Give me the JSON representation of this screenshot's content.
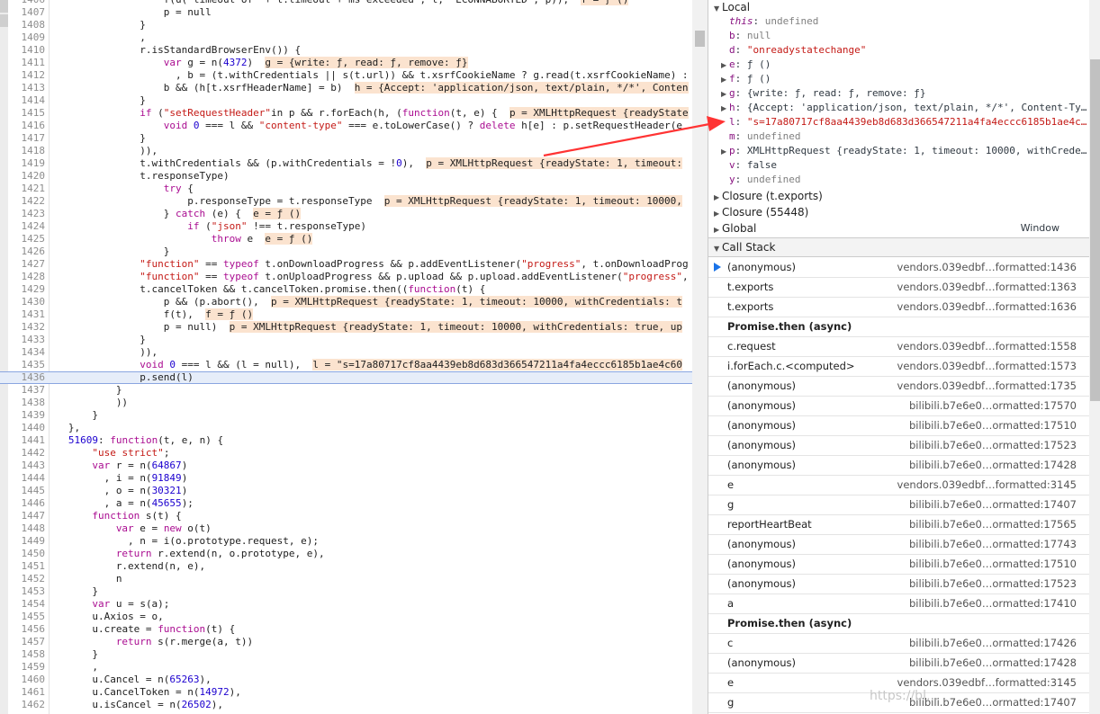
{
  "code_lines": [
    {
      "n": "1406",
      "indent": 19,
      "parts": [
        {
          "t": "f(u( timeout of  + t.timeout + ms exceeded , t,  ECONNABORTED , p)),  "
        },
        {
          "t": "f = ƒ ()",
          "c": "inl"
        }
      ]
    },
    {
      "n": "1407",
      "indent": 19,
      "parts": [
        {
          "t": "p = null"
        }
      ]
    },
    {
      "n": "1408",
      "indent": 15,
      "parts": [
        {
          "t": "}"
        }
      ]
    },
    {
      "n": "1409",
      "indent": 15,
      "parts": [
        {
          "t": ","
        }
      ]
    },
    {
      "n": "1410",
      "indent": 15,
      "parts": [
        {
          "t": "r.isStandardBrowserEnv()) {"
        }
      ]
    },
    {
      "n": "1411",
      "indent": 19,
      "parts": [
        {
          "t": "var",
          "c": "kw"
        },
        {
          "t": " g = n("
        },
        {
          "t": "4372",
          "c": "num"
        },
        {
          "t": ")  "
        },
        {
          "t": "g = {write: ƒ, read: ƒ, remove: ƒ}",
          "c": "inl"
        }
      ]
    },
    {
      "n": "1412",
      "indent": 21,
      "parts": [
        {
          "t": ", b = (t.withCredentials || s(t.url)) && t.xsrfCookieName ? g.read(t.xsrfCookieName) :"
        }
      ]
    },
    {
      "n": "1413",
      "indent": 19,
      "parts": [
        {
          "t": "b && (h[t.xsrfHeaderName] = b)  "
        },
        {
          "t": "h = {Accept: 'application/json, text/plain, */*', Conten",
          "c": "inl"
        }
      ]
    },
    {
      "n": "1414",
      "indent": 15,
      "parts": [
        {
          "t": "}"
        }
      ]
    },
    {
      "n": "1415",
      "indent": 15,
      "parts": [
        {
          "t": "if",
          "c": "kw"
        },
        {
          "t": " ("
        },
        {
          "t": "\"setRequestHeader\"",
          "c": "str"
        },
        {
          "t": "in p && r.forEach(h, ("
        },
        {
          "t": "function",
          "c": "kw"
        },
        {
          "t": "(t, e) {  "
        },
        {
          "t": "p = XMLHttpRequest {readyState",
          "c": "inl"
        }
      ]
    },
    {
      "n": "1416",
      "indent": 19,
      "parts": [
        {
          "t": "void",
          "c": "kw"
        },
        {
          "t": " "
        },
        {
          "t": "0",
          "c": "num"
        },
        {
          "t": " === l && "
        },
        {
          "t": "\"content-type\"",
          "c": "str"
        },
        {
          "t": " === e.toLowerCase() ? "
        },
        {
          "t": "delete",
          "c": "kw"
        },
        {
          "t": " h[e] : p.setRequestHeader(e"
        }
      ]
    },
    {
      "n": "1417",
      "indent": 15,
      "parts": [
        {
          "t": "}"
        }
      ]
    },
    {
      "n": "1418",
      "indent": 15,
      "parts": [
        {
          "t": ")),"
        }
      ]
    },
    {
      "n": "1419",
      "indent": 15,
      "parts": [
        {
          "t": "t.withCredentials && (p.withCredentials = !"
        },
        {
          "t": "0",
          "c": "num"
        },
        {
          "t": "),  "
        },
        {
          "t": "p = XMLHttpRequest {readyState: 1, timeout:",
          "c": "inl"
        }
      ]
    },
    {
      "n": "1420",
      "indent": 15,
      "parts": [
        {
          "t": "t.responseType)"
        }
      ]
    },
    {
      "n": "1421",
      "indent": 19,
      "parts": [
        {
          "t": "try",
          "c": "kw"
        },
        {
          "t": " {"
        }
      ]
    },
    {
      "n": "1422",
      "indent": 23,
      "parts": [
        {
          "t": "p.responseType = t.responseType  "
        },
        {
          "t": "p = XMLHttpRequest {readyState: 1, timeout: 10000,",
          "c": "inl"
        }
      ]
    },
    {
      "n": "1423",
      "indent": 19,
      "parts": [
        {
          "t": "} "
        },
        {
          "t": "catch",
          "c": "kw"
        },
        {
          "t": " (e) {  "
        },
        {
          "t": "e = ƒ ()",
          "c": "inl"
        }
      ]
    },
    {
      "n": "1424",
      "indent": 23,
      "parts": [
        {
          "t": "if",
          "c": "kw"
        },
        {
          "t": " ("
        },
        {
          "t": "\"json\"",
          "c": "str"
        },
        {
          "t": " !== t.responseType)"
        }
      ]
    },
    {
      "n": "1425",
      "indent": 27,
      "parts": [
        {
          "t": "throw",
          "c": "kw"
        },
        {
          "t": " e  "
        },
        {
          "t": "e = ƒ ()",
          "c": "inl"
        }
      ]
    },
    {
      "n": "1426",
      "indent": 19,
      "parts": [
        {
          "t": "}"
        }
      ]
    },
    {
      "n": "1427",
      "indent": 15,
      "parts": [
        {
          "t": "\"function\"",
          "c": "str"
        },
        {
          "t": " == "
        },
        {
          "t": "typeof",
          "c": "kw"
        },
        {
          "t": " t.onDownloadProgress && p.addEventListener("
        },
        {
          "t": "\"progress\"",
          "c": "str"
        },
        {
          "t": ", t.onDownloadProg"
        }
      ]
    },
    {
      "n": "1428",
      "indent": 15,
      "parts": [
        {
          "t": "\"function\"",
          "c": "str"
        },
        {
          "t": " == "
        },
        {
          "t": "typeof",
          "c": "kw"
        },
        {
          "t": " t.onUploadProgress && p.upload && p.upload.addEventListener("
        },
        {
          "t": "\"progress\"",
          "c": "str"
        },
        {
          "t": ","
        }
      ]
    },
    {
      "n": "1429",
      "indent": 15,
      "parts": [
        {
          "t": "t.cancelToken && t.cancelToken.promise.then(("
        },
        {
          "t": "function",
          "c": "kw"
        },
        {
          "t": "(t) {"
        }
      ]
    },
    {
      "n": "1430",
      "indent": 19,
      "parts": [
        {
          "t": "p && (p.abort(),  "
        },
        {
          "t": "p = XMLHttpRequest {readyState: 1, timeout: 10000, withCredentials: t",
          "c": "inl"
        }
      ]
    },
    {
      "n": "1431",
      "indent": 19,
      "parts": [
        {
          "t": "f(t),  "
        },
        {
          "t": "f = ƒ ()",
          "c": "inl"
        }
      ]
    },
    {
      "n": "1432",
      "indent": 19,
      "parts": [
        {
          "t": "p = null)  "
        },
        {
          "t": "p = XMLHttpRequest {readyState: 1, timeout: 10000, withCredentials: true, up",
          "c": "inl"
        }
      ]
    },
    {
      "n": "1433",
      "indent": 15,
      "parts": [
        {
          "t": "}"
        }
      ]
    },
    {
      "n": "1434",
      "indent": 15,
      "parts": [
        {
          "t": ")),"
        }
      ]
    },
    {
      "n": "1435",
      "indent": 15,
      "parts": [
        {
          "t": "void",
          "c": "kw"
        },
        {
          "t": " "
        },
        {
          "t": "0",
          "c": "num"
        },
        {
          "t": " === l && (l = null),  "
        },
        {
          "t": "l = \"s=17a80717cf8aa4439eb8d683d366547211a4fa4eccc6185b1ae4c60",
          "c": "inl"
        }
      ]
    },
    {
      "n": "1436",
      "indent": 15,
      "hl": true,
      "parts": [
        {
          "t": "p.send(l)"
        }
      ]
    },
    {
      "n": "1437",
      "indent": 11,
      "parts": [
        {
          "t": "}"
        }
      ]
    },
    {
      "n": "1438",
      "indent": 11,
      "parts": [
        {
          "t": "))"
        }
      ]
    },
    {
      "n": "1439",
      "indent": 7,
      "parts": [
        {
          "t": "}"
        }
      ]
    },
    {
      "n": "1440",
      "indent": 3,
      "parts": [
        {
          "t": "},"
        }
      ]
    },
    {
      "n": "1441",
      "indent": 3,
      "parts": [
        {
          "t": "51609",
          "c": "num"
        },
        {
          "t": ": "
        },
        {
          "t": "function",
          "c": "kw"
        },
        {
          "t": "(t, e, n) {"
        }
      ]
    },
    {
      "n": "1442",
      "indent": 7,
      "parts": [
        {
          "t": "\"use strict\"",
          "c": "str"
        },
        {
          "t": ";"
        }
      ]
    },
    {
      "n": "1443",
      "indent": 7,
      "parts": [
        {
          "t": "var",
          "c": "kw"
        },
        {
          "t": " r = n("
        },
        {
          "t": "64867",
          "c": "num"
        },
        {
          "t": ")"
        }
      ]
    },
    {
      "n": "1444",
      "indent": 9,
      "parts": [
        {
          "t": ", i = n("
        },
        {
          "t": "91849",
          "c": "num"
        },
        {
          "t": ")"
        }
      ]
    },
    {
      "n": "1445",
      "indent": 9,
      "parts": [
        {
          "t": ", o = n("
        },
        {
          "t": "30321",
          "c": "num"
        },
        {
          "t": ")"
        }
      ]
    },
    {
      "n": "1446",
      "indent": 9,
      "parts": [
        {
          "t": ", a = n("
        },
        {
          "t": "45655",
          "c": "num"
        },
        {
          "t": ");"
        }
      ]
    },
    {
      "n": "1447",
      "indent": 7,
      "parts": [
        {
          "t": "function",
          "c": "kw"
        },
        {
          "t": " s(t) {"
        }
      ]
    },
    {
      "n": "1448",
      "indent": 11,
      "parts": [
        {
          "t": "var",
          "c": "kw"
        },
        {
          "t": " e = "
        },
        {
          "t": "new",
          "c": "kw"
        },
        {
          "t": " o(t)"
        }
      ]
    },
    {
      "n": "1449",
      "indent": 13,
      "parts": [
        {
          "t": ", n = i(o.prototype.request, e);"
        }
      ]
    },
    {
      "n": "1450",
      "indent": 11,
      "parts": [
        {
          "t": "return",
          "c": "kw"
        },
        {
          "t": " r.extend(n, o.prototype, e),"
        }
      ]
    },
    {
      "n": "1451",
      "indent": 11,
      "parts": [
        {
          "t": "r.extend(n, e),"
        }
      ]
    },
    {
      "n": "1452",
      "indent": 11,
      "parts": [
        {
          "t": "n"
        }
      ]
    },
    {
      "n": "1453",
      "indent": 7,
      "parts": [
        {
          "t": "}"
        }
      ]
    },
    {
      "n": "1454",
      "indent": 7,
      "parts": [
        {
          "t": "var",
          "c": "kw"
        },
        {
          "t": " u = s(a);"
        }
      ]
    },
    {
      "n": "1455",
      "indent": 7,
      "parts": [
        {
          "t": "u.Axios = o,"
        }
      ]
    },
    {
      "n": "1456",
      "indent": 7,
      "parts": [
        {
          "t": "u.create = "
        },
        {
          "t": "function",
          "c": "kw"
        },
        {
          "t": "(t) {"
        }
      ]
    },
    {
      "n": "1457",
      "indent": 11,
      "parts": [
        {
          "t": "return",
          "c": "kw"
        },
        {
          "t": " s(r.merge(a, t))"
        }
      ]
    },
    {
      "n": "1458",
      "indent": 7,
      "parts": [
        {
          "t": "}"
        }
      ]
    },
    {
      "n": "1459",
      "indent": 7,
      "parts": [
        {
          "t": ","
        }
      ]
    },
    {
      "n": "1460",
      "indent": 7,
      "parts": [
        {
          "t": "u.Cancel = n("
        },
        {
          "t": "65263",
          "c": "num"
        },
        {
          "t": "),"
        }
      ]
    },
    {
      "n": "1461",
      "indent": 7,
      "parts": [
        {
          "t": "u.CancelToken = n("
        },
        {
          "t": "14972",
          "c": "num"
        },
        {
          "t": "),"
        }
      ]
    },
    {
      "n": "1462",
      "indent": 7,
      "parts": [
        {
          "t": "u.isCancel = n("
        },
        {
          "t": "26502",
          "c": "num"
        },
        {
          "t": "),"
        }
      ]
    }
  ],
  "scope": {
    "local_label": "Local",
    "props": [
      {
        "name": "this",
        "sep": ": ",
        "value": "undefined",
        "vc": "pnull",
        "expand": false,
        "this": true
      },
      {
        "name": "b",
        "sep": ": ",
        "value": "null",
        "vc": "pnull",
        "expand": false
      },
      {
        "name": "d",
        "sep": ": ",
        "value": "\"onreadystatechange\"",
        "vc": "pstr",
        "expand": false
      },
      {
        "name": "e",
        "sep": ": ",
        "value": "ƒ ()",
        "vc": "pobj",
        "expand": true
      },
      {
        "name": "f",
        "sep": ": ",
        "value": "ƒ ()",
        "vc": "pobj",
        "expand": true
      },
      {
        "name": "g",
        "sep": ": ",
        "value": "{write: ƒ, read: ƒ, remove: ƒ}",
        "vc": "pobj",
        "expand": true
      },
      {
        "name": "h",
        "sep": ": ",
        "value": "{Accept: 'application/json, text/plain, */*', Content-Ty…",
        "vc": "pobj",
        "expand": true
      },
      {
        "name": "l",
        "sep": ": ",
        "value": "\"s=17a80717cf8aa4439eb8d683d366547211a4fa4eccc6185b1ae4c…",
        "vc": "pstr",
        "expand": false
      },
      {
        "name": "m",
        "sep": ": ",
        "value": "undefined",
        "vc": "pnull",
        "expand": false
      },
      {
        "name": "p",
        "sep": ": ",
        "value": "XMLHttpRequest {readyState: 1, timeout: 10000, withCrede…",
        "vc": "pobj",
        "expand": true
      },
      {
        "name": "v",
        "sep": ": ",
        "value": "false",
        "vc": "pobj",
        "expand": false
      },
      {
        "name": "y",
        "sep": ": ",
        "value": "undefined",
        "vc": "pnull",
        "expand": false
      }
    ],
    "closures": [
      "Closure (t.exports)",
      "Closure (55448)"
    ],
    "global_label": "Global",
    "global_value": "Window"
  },
  "call_stack": {
    "title": "Call Stack",
    "rows": [
      {
        "type": "frame",
        "name": "(anonymous)",
        "loc": "vendors.039edbf…formatted:1436",
        "current": true
      },
      {
        "type": "frame",
        "name": "t.exports",
        "loc": "vendors.039edbf…formatted:1363"
      },
      {
        "type": "frame",
        "name": "t.exports",
        "loc": "vendors.039edbf…formatted:1636"
      },
      {
        "type": "async",
        "name": "Promise.then (async)"
      },
      {
        "type": "frame",
        "name": "c.request",
        "loc": "vendors.039edbf…formatted:1558"
      },
      {
        "type": "frame",
        "name": "i.forEach.c.<computed>",
        "loc": "vendors.039edbf…formatted:1573"
      },
      {
        "type": "frame",
        "name": "(anonymous)",
        "loc": "vendors.039edbf…formatted:1735"
      },
      {
        "type": "frame",
        "name": "(anonymous)",
        "loc": "bilibili.b7e6e0…ormatted:17570"
      },
      {
        "type": "frame",
        "name": "(anonymous)",
        "loc": "bilibili.b7e6e0…ormatted:17510"
      },
      {
        "type": "frame",
        "name": "(anonymous)",
        "loc": "bilibili.b7e6e0…ormatted:17523"
      },
      {
        "type": "frame",
        "name": "(anonymous)",
        "loc": "bilibili.b7e6e0…ormatted:17428"
      },
      {
        "type": "frame",
        "name": "e",
        "loc": "vendors.039edbf…formatted:3145"
      },
      {
        "type": "frame",
        "name": "g",
        "loc": "bilibili.b7e6e0…ormatted:17407"
      },
      {
        "type": "frame",
        "name": "reportHeartBeat",
        "loc": "bilibili.b7e6e0…ormatted:17565"
      },
      {
        "type": "frame",
        "name": "(anonymous)",
        "loc": "bilibili.b7e6e0…ormatted:17743"
      },
      {
        "type": "frame",
        "name": "(anonymous)",
        "loc": "bilibili.b7e6e0…ormatted:17510"
      },
      {
        "type": "frame",
        "name": "(anonymous)",
        "loc": "bilibili.b7e6e0…ormatted:17523"
      },
      {
        "type": "frame",
        "name": "a",
        "loc": "bilibili.b7e6e0…ormatted:17410"
      },
      {
        "type": "async",
        "name": "Promise.then (async)"
      },
      {
        "type": "frame",
        "name": "c",
        "loc": "bilibili.b7e6e0…ormatted:17426"
      },
      {
        "type": "frame",
        "name": "(anonymous)",
        "loc": "bilibili.b7e6e0…ormatted:17428"
      },
      {
        "type": "frame",
        "name": "e",
        "loc": "vendors.039edbf…formatted:3145"
      },
      {
        "type": "frame",
        "name": "g",
        "loc": "bilibili.b7e6e0…ormatted:17407"
      }
    ]
  },
  "watermark": "https://bl…",
  "colors": {
    "annotation_arrow": "#ff3333",
    "current_frame_arrow": "#1a73e8",
    "inline_value_bg": "#fbe3cf"
  }
}
